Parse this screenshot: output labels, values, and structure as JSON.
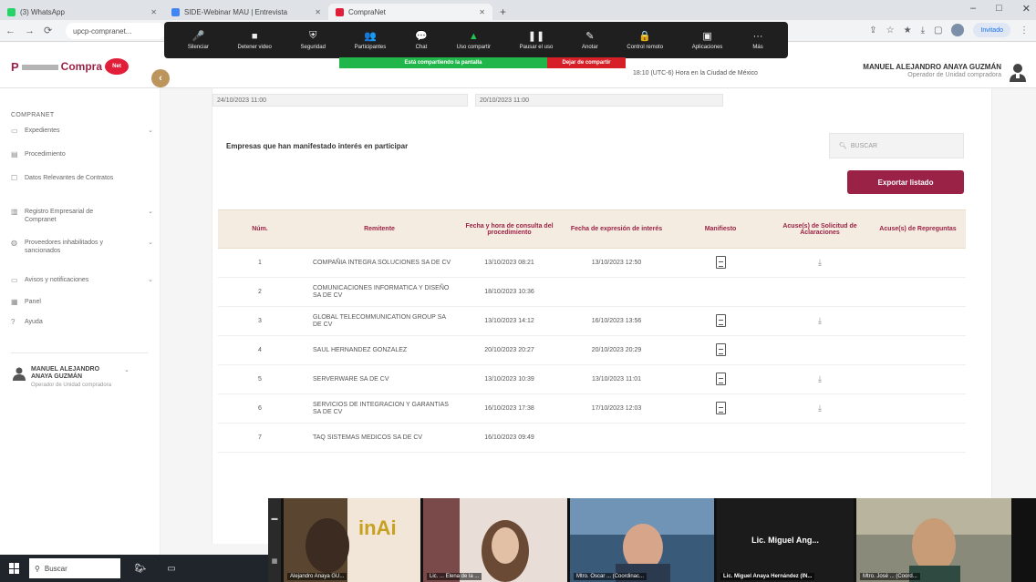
{
  "browser": {
    "tabs": [
      {
        "label": "(3) WhatsApp",
        "color": "#25d366",
        "active": false
      },
      {
        "label": "SIDE-Webinar MAU | Entrevista",
        "color": "#4285f4",
        "active": false
      },
      {
        "label": "CompraNet",
        "color": "#e21f39",
        "active": true
      }
    ],
    "url": "upcp-compranet...",
    "profile_label": "Invitado",
    "window_controls": {
      "min": "–",
      "max": "□",
      "close": "✕"
    }
  },
  "zoom": {
    "items": [
      {
        "icon": "🎤",
        "label": "Silenciar"
      },
      {
        "icon": "■",
        "label": "Detener video"
      },
      {
        "icon": "⛨",
        "label": "Seguridad"
      },
      {
        "icon": "👥",
        "label": "Participantes"
      },
      {
        "icon": "💬",
        "label": "Chat"
      },
      {
        "icon": "▲",
        "label": "Uso compartir",
        "green": true
      },
      {
        "icon": "❚❚",
        "label": "Pausar el uso"
      },
      {
        "icon": "✎",
        "label": "Anotar"
      },
      {
        "icon": "🔒",
        "label": "Control remoto"
      },
      {
        "icon": "▣",
        "label": "Aplicaciones"
      },
      {
        "icon": "···",
        "label": "Más"
      }
    ],
    "sharing_text": "Está compartiendo la pantalla",
    "stop_share": "Dejar de compartir"
  },
  "header": {
    "logo_prefix": "P",
    "logo_text": "Compra",
    "logo_badge": "Net",
    "timezone": "18:10 (UTC-6) Hora en la Ciudad de México",
    "user_name": "MANUEL ALEJANDRO ANAYA GUZMÁN",
    "user_role": "Operador de Unidad compradora"
  },
  "sidebar": {
    "section": "COMPRANET",
    "items": [
      {
        "icon": "▭",
        "label": "Expedientes",
        "arrow": "⌄"
      },
      {
        "icon": "▤",
        "label": "Procedimiento",
        "arrow": ""
      },
      {
        "icon": "☐",
        "label": "Datos Relevantes de Contratos",
        "arrow": ""
      },
      {
        "icon": "▥",
        "label": "Registro Empresarial de Compranet",
        "arrow": "⌄"
      },
      {
        "icon": "◍",
        "label": "Proveedores inhabilitados y sancionados",
        "arrow": "⌄"
      },
      {
        "icon": "▭",
        "label": "Avisos y notificaciones",
        "arrow": "⌄"
      },
      {
        "icon": "▦",
        "label": "Panel",
        "arrow": ""
      },
      {
        "icon": "?",
        "label": "Ayuda",
        "arrow": ""
      }
    ],
    "user_name": "MANUEL ALEJANDRO ANAYA GUZMÁN",
    "user_role": "Operador de Unidad compradora",
    "user_arrow": "⌄"
  },
  "main": {
    "date_1": "24/10/2023 11:00",
    "date_2": "20/10/2023 11:00",
    "section_title": "Empresas que han manifestado interés en participar",
    "search_placeholder": "BUSCAR",
    "export_label": "Exportar listado",
    "columns": [
      "Núm.",
      "Remitente",
      "Fecha y hora de consulta del procedimiento",
      "Fecha de expresión de interés",
      "Manifiesto",
      "Acuse(s) de Solicitud de Aclaraciones",
      "Acuse(s) de Repreguntas"
    ],
    "rows": [
      {
        "num": "1",
        "rem": "COMPAÑIA INTEGRA SOLUCIONES SA DE CV",
        "consulta": "13/10/2023 08:21",
        "interes": "13/10/2023 12:50",
        "pdf": true,
        "dl": true
      },
      {
        "num": "2",
        "rem": "COMUNICACIONES INFORMATICA Y DISEÑO SA DE CV",
        "consulta": "18/10/2023 10:36",
        "interes": "",
        "pdf": false,
        "dl": false
      },
      {
        "num": "3",
        "rem": "GLOBAL TELECOMMUNICATION GROUP SA DE CV",
        "consulta": "13/10/2023 14:12",
        "interes": "16/10/2023 13:56",
        "pdf": true,
        "dl": true
      },
      {
        "num": "4",
        "rem": "SAUL HERNANDEZ GONZALEZ",
        "consulta": "20/10/2023 20:27",
        "interes": "20/10/2023 20:29",
        "pdf": true,
        "dl": false
      },
      {
        "num": "5",
        "rem": "SERVERWARE SA DE CV",
        "consulta": "13/10/2023 10:39",
        "interes": "13/10/2023 11:01",
        "pdf": true,
        "dl": true
      },
      {
        "num": "6",
        "rem": "SERVICIOS DE INTEGRACION Y GARANTIAS SA DE CV",
        "consulta": "16/10/2023 17:38",
        "interes": "17/10/2023 12:03",
        "pdf": true,
        "dl": true
      },
      {
        "num": "7",
        "rem": "TAQ SISTEMAS MEDICOS SA DE CV",
        "consulta": "16/10/2023 09:49",
        "interes": "",
        "pdf": false,
        "dl": false
      }
    ]
  },
  "videos": [
    {
      "name": "Alejandro Anaya GU...",
      "bg": "#5a4530"
    },
    {
      "name": "Lic. ... Elena de la ...",
      "bg": "#7a4a4a"
    },
    {
      "name": "Mtro. Oscar ... (Coordinac...",
      "bg": "#3a5a7a"
    },
    {
      "name": "Lic. Miguel Anaya Hernández (IN...",
      "bg": "#1b1b1b",
      "label": "Lic. Miguel Ang..."
    },
    {
      "name": "Mtro. José ... (Coord...",
      "bg": "#4a6a5a"
    }
  ],
  "taskbar": {
    "search_label": "Buscar"
  }
}
